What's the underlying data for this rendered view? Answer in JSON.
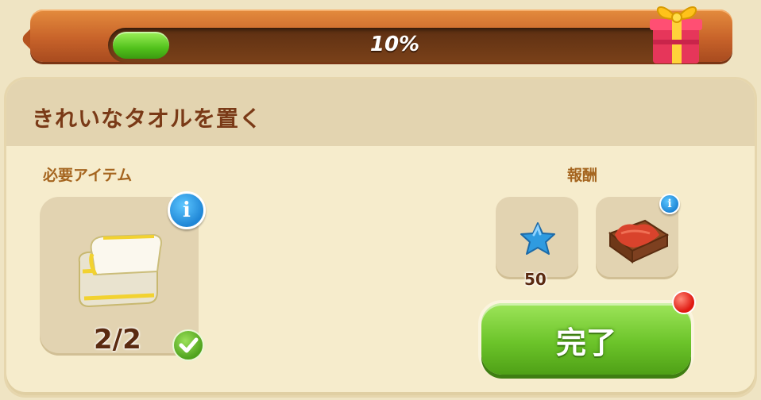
{
  "progress": {
    "percent_label": "10%",
    "fraction": 0.1
  },
  "quest": {
    "title": "きれいなタオルを置く",
    "required_label": "必要アイテム",
    "reward_label": "報酬",
    "required_item": {
      "icon": "folded-towel-icon",
      "count": "2/2",
      "complete": true
    },
    "rewards": [
      {
        "icon": "blue-star-icon",
        "amount": "50"
      },
      {
        "icon": "red-cloth-crate-icon",
        "amount": ""
      }
    ],
    "complete_button": "完了"
  },
  "colors": {
    "banner_orange": "#c8632a",
    "progress_green": "#52c21c",
    "title_brown": "#7a3a17",
    "button_green": "#6cc42a",
    "info_blue": "#1f86d6",
    "notification_red": "#e01a12"
  }
}
